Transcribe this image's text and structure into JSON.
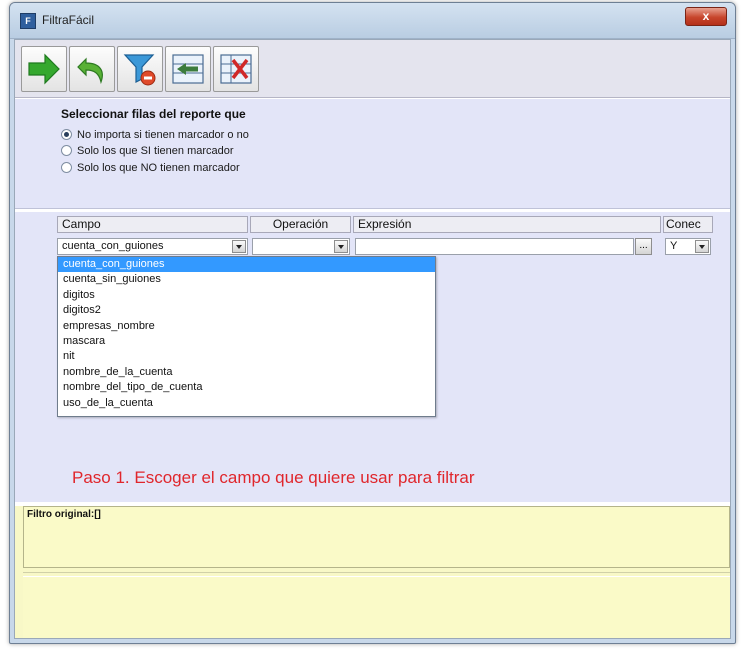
{
  "window": {
    "title": "FiltraFácil",
    "close_label": "x"
  },
  "toolbar": {
    "buttons": [
      {
        "icon": "arrow-right-icon",
        "color": "#35a82e"
      },
      {
        "icon": "undo-icon",
        "color": "#58b135"
      },
      {
        "icon": "filter-remove-icon",
        "color": "#3b98d8"
      },
      {
        "icon": "insert-row-icon",
        "color": "#3c7c3c"
      },
      {
        "icon": "delete-row-icon",
        "color": "#d02828"
      }
    ]
  },
  "selection": {
    "title": "Seleccionar filas del reporte que",
    "options": [
      {
        "label": "No importa si tienen marcador o no",
        "checked": true
      },
      {
        "label": "Solo los que SI tienen marcador",
        "checked": false
      },
      {
        "label": "Solo los que NO tienen marcador",
        "checked": false
      }
    ]
  },
  "grid": {
    "headers": {
      "campo": "Campo",
      "operacion": "Operación",
      "expresion": "Expresión",
      "conector": "Conec"
    },
    "row": {
      "campo": "cuenta_con_guiones",
      "operacion": "",
      "expresion": "",
      "ellipsis": "...",
      "conector": "Y"
    },
    "dropdown_items": [
      "cuenta_con_guiones",
      "cuenta_sin_guiones",
      "digitos",
      "digitos2",
      "empresas_nombre",
      "mascara",
      "nit",
      "nombre_de_la_cuenta",
      "nombre_del_tipo_de_cuenta",
      "uso_de_la_cuenta"
    ],
    "selected_index": 0
  },
  "hint": "Paso 1.  Escoger el campo que quiere usar para filtrar",
  "filter": {
    "label": "Filtro original:[]"
  },
  "colors": {
    "hint": "#e0262c",
    "selection_highlight": "#3399ff",
    "panel": "#e3e5f8",
    "filter_panel": "#f8f8c7"
  }
}
